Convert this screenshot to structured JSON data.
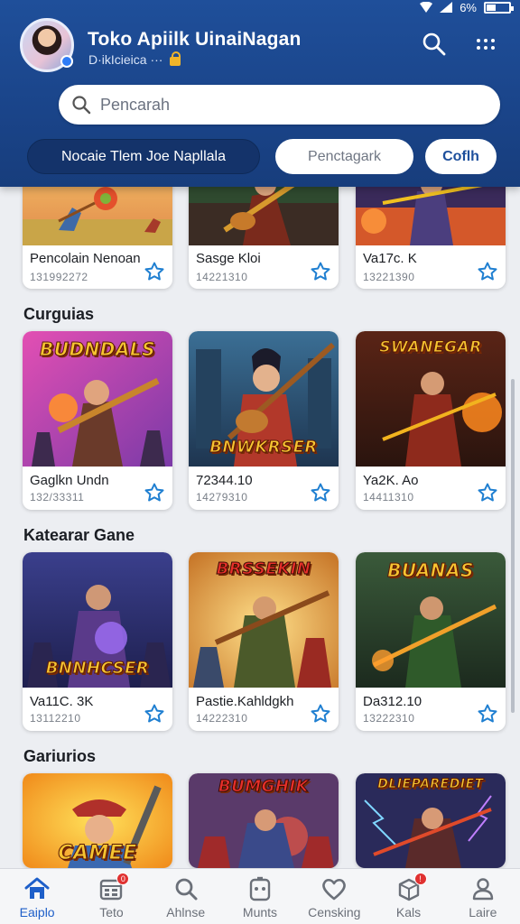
{
  "status_bar": {
    "battery_text": "6%"
  },
  "header": {
    "title": "Toko Apiilk UinaiNagan",
    "subtitle": "D·ikIcieica ···",
    "search_placeholder": "Pencarah",
    "chips": [
      "Nocaie Tlem Joe Napllala",
      "Penctagark",
      "Coflh"
    ]
  },
  "sections": [
    {
      "title": "",
      "cards": [
        {
          "name": "Pencolain Nenoan",
          "meta": "131992272",
          "art": "field"
        },
        {
          "name": "Sasge Kloi",
          "meta": "14221310",
          "art": "green"
        },
        {
          "name": "Va17c. K",
          "meta": "13221390",
          "art": "fire"
        }
      ]
    },
    {
      "title": "Curguias",
      "cards": [
        {
          "name": "Gaglkn Undn",
          "meta": "132/33311",
          "art": "pink",
          "banner": "BUDNDALS"
        },
        {
          "name": "72344.10",
          "meta": "14279310",
          "art": "blue",
          "banner": "BNWKRSER"
        },
        {
          "name": "Ya2K. Ao",
          "meta": "14411310",
          "art": "fire",
          "banner": "SWANEGAR"
        }
      ]
    },
    {
      "title": "Katearar Gane",
      "cards": [
        {
          "name": "Va11C. 3K",
          "meta": "13112210",
          "art": "purple",
          "banner": "BNNHCSER"
        },
        {
          "name": "Pastie.Kahldgkh",
          "meta": "14222310",
          "art": "gold",
          "banner": "BRSSEKIN"
        },
        {
          "name": "Da312.10",
          "meta": "13222310",
          "art": "green",
          "banner": "BUANAS"
        }
      ]
    },
    {
      "title": "Gariurios",
      "cards": [
        {
          "name": "",
          "meta": "",
          "art": "yellow",
          "banner": "CAMEE"
        },
        {
          "name": "",
          "meta": "",
          "art": "red",
          "banner": "BUMGHIK"
        },
        {
          "name": "",
          "meta": "",
          "art": "storm",
          "banner": "DLIEPAREDIET"
        }
      ]
    }
  ],
  "bottom_nav": [
    {
      "label": "Eaiplo",
      "icon": "home-icon",
      "active": true
    },
    {
      "label": "Teto",
      "icon": "calendar-icon",
      "badge": "0"
    },
    {
      "label": "Ahlnse",
      "icon": "search-icon"
    },
    {
      "label": "Munts",
      "icon": "gamepad-icon"
    },
    {
      "label": "Censking",
      "icon": "heart-icon"
    },
    {
      "label": "Kals",
      "icon": "box-icon",
      "badge": "!"
    },
    {
      "label": "Laire",
      "icon": "profile-icon"
    }
  ],
  "colors": {
    "header": "#1a4489",
    "accent": "#1e5fc9",
    "star": "#1f7fd1"
  }
}
